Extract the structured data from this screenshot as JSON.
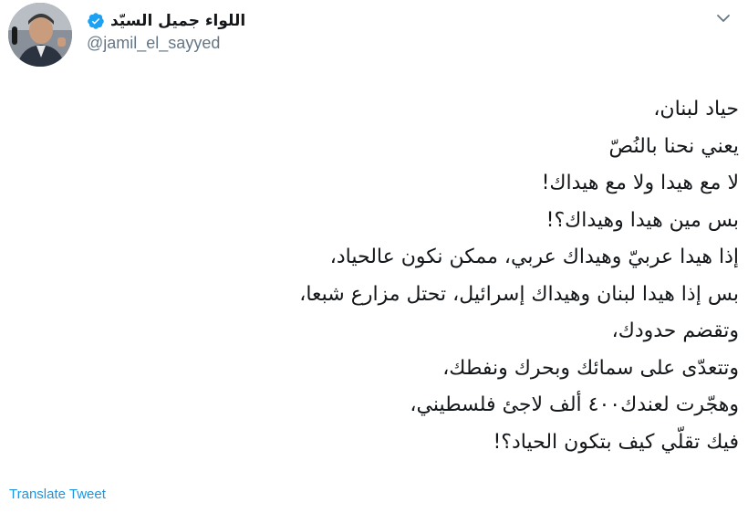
{
  "author": {
    "display_name": "اللواء جميل السيّد",
    "handle": "@jamil_el_sayyed",
    "verified": true
  },
  "icons": {
    "verified": "verified-badge-icon",
    "caret": "chevron-down-icon",
    "accent_color": "#1da1f2"
  },
  "tweet": {
    "lines": [
      "حياد لبنان،",
      "يعني نحنا بالنُصّ",
      "لا مع هيدا ولا مع هيداك!",
      "بس مين هيدا وهيداك؟!",
      "إذا هيدا عربيّ وهيداك عربي، ممكن نكون عالحياد،",
      "بس إذا هيدا لبنان وهيداك إسرائيل، تحتل مزارع شبعا،",
      "وتقضم حدودك،",
      "وتتعدّى على سمائك وبحرك ونفطك،",
      "وهجّرت لعندك٤٠٠ ألف لاجئ فلسطيني،",
      "فيك تقلّي كيف بتكون الحياد؟!"
    ]
  },
  "actions": {
    "translate_label": "Translate Tweet"
  }
}
